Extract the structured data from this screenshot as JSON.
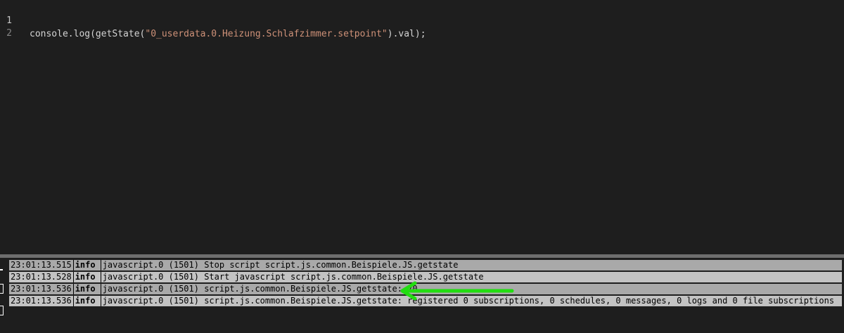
{
  "editor": {
    "lines": [
      {
        "number": "1",
        "tokens": [
          {
            "type": "plain",
            "text": "console.log(getState("
          },
          {
            "type": "string",
            "text": "\"0_userdata.0.Heizung.Schlafzimmer.setpoint\""
          },
          {
            "type": "plain",
            "text": ").val);"
          }
        ]
      },
      {
        "number": "2",
        "tokens": []
      }
    ]
  },
  "log": {
    "rows": [
      {
        "time": "23:01:13.515",
        "level": "info",
        "message": "javascript.0 (1501) Stop script script.js.common.Beispiele.JS.getstate"
      },
      {
        "time": "23:01:13.528",
        "level": "info",
        "message": "javascript.0 (1501) Start javascript script.js.common.Beispiele.JS.getstate"
      },
      {
        "time": "23:01:13.536",
        "level": "info",
        "message": "javascript.0 (1501) script.js.common.Beispiele.JS.getstate: 20"
      },
      {
        "time": "23:01:13.536",
        "level": "info",
        "message": "javascript.0 (1501) script.js.common.Beispiele.JS.getstate: registered 0 subscriptions, 0 schedules, 0 messages, 0 logs and 0 file subscriptions"
      }
    ]
  },
  "annotation": {
    "arrow_color": "#22dd11",
    "points_to_row": 2
  },
  "colors": {
    "editor_bg": "#1e1e1e",
    "string": "#ce9178",
    "log_row_bg": "#a9a9a9",
    "log_row_alt_bg": "#c3c3c3"
  }
}
